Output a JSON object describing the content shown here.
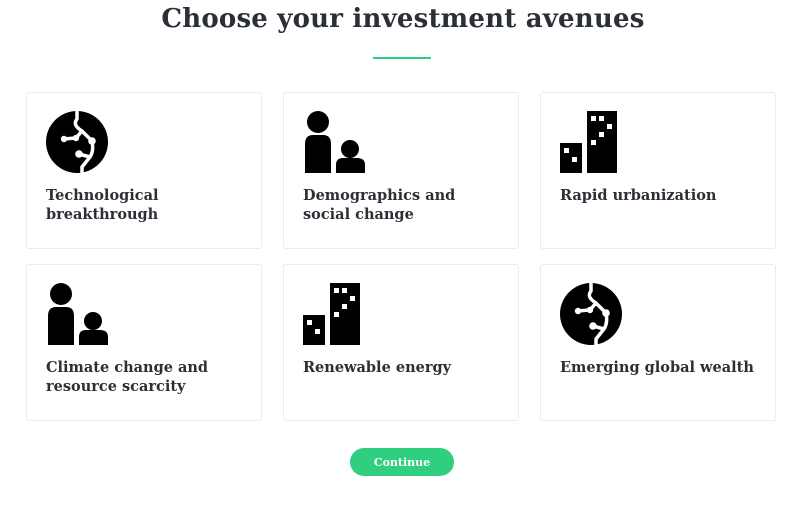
{
  "page": {
    "title": "Choose your investment avenues",
    "accent_color": "#2ecc7e"
  },
  "avenues": [
    {
      "label": "Technological breakthrough",
      "icon": "circuit-globe-icon"
    },
    {
      "label": "Demographics and social change",
      "icon": "people-icon"
    },
    {
      "label": "Rapid urbanization",
      "icon": "buildings-icon"
    },
    {
      "label": "Climate change and resource scarcity",
      "icon": "people-icon"
    },
    {
      "label": "Renewable energy",
      "icon": "buildings-icon"
    },
    {
      "label": "Emerging global wealth",
      "icon": "circuit-globe-icon"
    }
  ],
  "actions": {
    "continue_label": "Continue",
    "continue_color": "#2fcf7f"
  }
}
